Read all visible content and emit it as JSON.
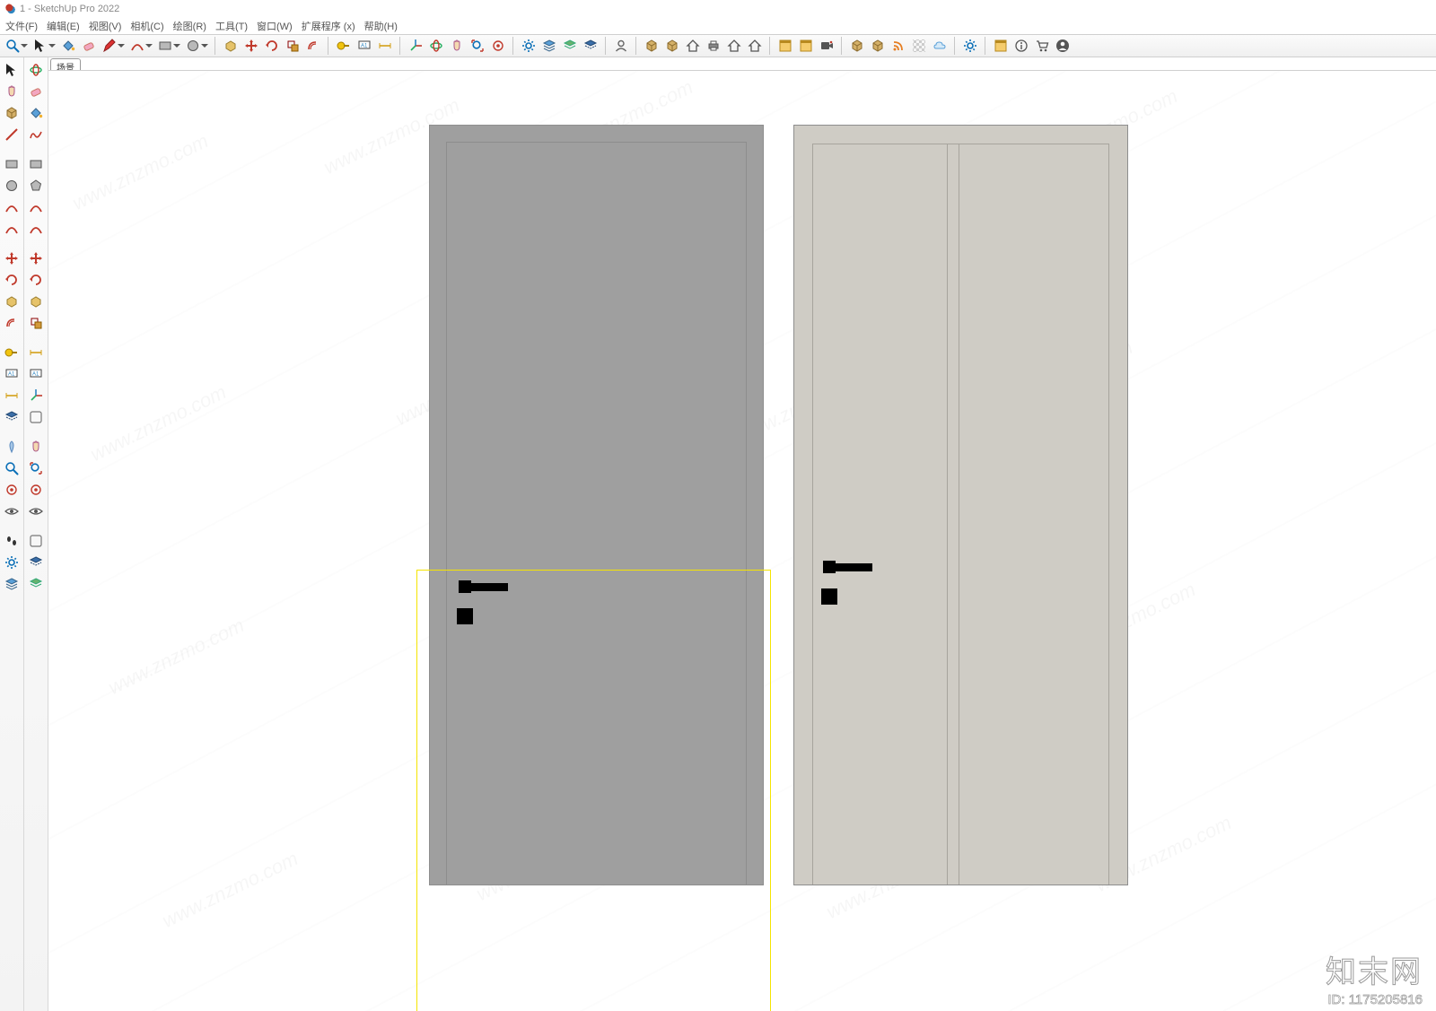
{
  "title": "1 - SketchUp Pro 2022",
  "menus": [
    {
      "label": "文件(F)"
    },
    {
      "label": "编辑(E)"
    },
    {
      "label": "视图(V)"
    },
    {
      "label": "相机(C)"
    },
    {
      "label": "绘图(R)"
    },
    {
      "label": "工具(T)"
    },
    {
      "label": "窗口(W)"
    },
    {
      "label": "扩展程序 (x)"
    },
    {
      "label": "帮助(H)"
    }
  ],
  "scene_tab": "场景",
  "watermark": {
    "text": "www.znzmo.com",
    "brand": "知末网",
    "id_label": "ID: 1175205816"
  },
  "h_toolbar": [
    {
      "name": "zoom-icon",
      "dd": true
    },
    {
      "name": "select-icon",
      "dd": true
    },
    {
      "name": "paintbucket-icon",
      "dd": false
    },
    {
      "name": "eraser-icon",
      "dd": false
    },
    {
      "name": "pencil-icon",
      "dd": true
    },
    {
      "name": "arc-icon",
      "dd": true
    },
    {
      "name": "rectangle-icon",
      "dd": true
    },
    {
      "name": "circle-icon",
      "dd": true
    },
    {
      "sep": true
    },
    {
      "name": "pushpull-icon",
      "dd": false
    },
    {
      "name": "move-icon",
      "dd": false
    },
    {
      "name": "rotate-icon",
      "dd": false
    },
    {
      "name": "scale-icon",
      "dd": false
    },
    {
      "name": "offset-icon",
      "dd": false
    },
    {
      "sep": true
    },
    {
      "name": "tape-icon",
      "dd": false
    },
    {
      "name": "text-label-icon",
      "dd": false
    },
    {
      "name": "dimension-icon",
      "dd": false
    },
    {
      "sep": true
    },
    {
      "name": "axes-icon",
      "dd": false
    },
    {
      "name": "orbit-icon",
      "dd": false
    },
    {
      "name": "pan-icon",
      "dd": false
    },
    {
      "name": "zoom-extents-icon",
      "dd": false
    },
    {
      "name": "position-camera-icon",
      "dd": false
    },
    {
      "sep": true
    },
    {
      "name": "component-opts-icon",
      "dd": false
    },
    {
      "name": "layers-icon",
      "dd": false
    },
    {
      "name": "outliner-icon",
      "dd": false
    },
    {
      "name": "section-icon",
      "dd": false
    },
    {
      "sep": true
    },
    {
      "name": "user-icon",
      "dd": false
    },
    {
      "sep": true
    },
    {
      "name": "warehouse-icon",
      "dd": false
    },
    {
      "name": "extension-wh-icon",
      "dd": false
    },
    {
      "name": "home-icon",
      "dd": false
    },
    {
      "name": "print-icon",
      "dd": false
    },
    {
      "name": "export-icon",
      "dd": false
    },
    {
      "name": "import-icon",
      "dd": false
    },
    {
      "sep": true
    },
    {
      "name": "image-export-icon",
      "dd": false
    },
    {
      "name": "animation-icon",
      "dd": false
    },
    {
      "name": "record-icon",
      "dd": false
    },
    {
      "sep": true
    },
    {
      "name": "add-location-icon",
      "dd": false
    },
    {
      "name": "geo-icon",
      "dd": false
    },
    {
      "name": "rss-icon",
      "dd": false
    },
    {
      "name": "texture-icon",
      "dd": false
    },
    {
      "name": "cloud-icon",
      "dd": false
    },
    {
      "sep": true
    },
    {
      "name": "settings-icon",
      "dd": false
    },
    {
      "sep": true
    },
    {
      "name": "window-icon",
      "dd": false
    },
    {
      "name": "info-icon",
      "dd": false
    },
    {
      "name": "cart-icon",
      "dd": false
    },
    {
      "name": "account-icon",
      "dd": false
    }
  ],
  "v_col_left": [
    "select-arrow-icon",
    "orbit-view-icon",
    "pan-hand-icon",
    "eraser-tool-icon",
    "component-icon",
    "paint-fill-icon",
    "line-tool-icon",
    "freehand-icon",
    "rectangle-tool-icon",
    "rotated-rect-icon",
    "circle-tool-icon",
    "polygon-icon",
    "arc2pt-icon",
    "arc-center-icon",
    "arc-tool-icon",
    "pie-icon",
    "move-tool-icon",
    "move-copy-icon",
    "rotate-tool-icon",
    "rotate-copy-icon",
    "pushpull-tool-icon",
    "followme-icon",
    "offset-tool-icon",
    "scale-tool-icon",
    "tape-tool-icon",
    "protractor-icon",
    "text3d-icon",
    "text-note-icon",
    "dimension-tool-icon",
    "axes-tool-icon",
    "sectionplane-icon",
    "mirror-icon",
    "position-tool-icon",
    "pan-tool-icon",
    "zoom-tool-icon",
    "zoom-region-icon",
    "walk-icon",
    "look-icon",
    "camera-eye-icon",
    "lookaround-icon",
    "footprints-icon",
    "blank-icon",
    "styles-icon",
    "shadow-icon",
    "layers-tag-icon",
    "outliner-tree-icon"
  ]
}
